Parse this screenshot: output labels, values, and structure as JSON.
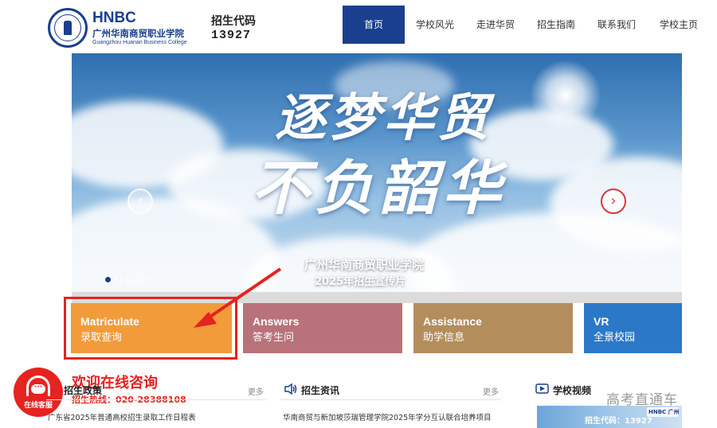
{
  "header": {
    "logo_seal_text": "广州华南商贸",
    "logo_abbr": "HNBC",
    "logo_name_cn": "广州华南商贸职业学院",
    "logo_name_en": "Guangzhou Huanan Business College",
    "code_label": "招生代码",
    "code_value": "13927"
  },
  "nav": {
    "items": [
      {
        "label": "首页",
        "active": true
      },
      {
        "label": "学校风光"
      },
      {
        "label": "走进华贸"
      },
      {
        "label": "招生指南"
      },
      {
        "label": "联系我们"
      },
      {
        "label": "学校主页"
      }
    ]
  },
  "banner": {
    "slogan_line1": "逐梦华贸",
    "slogan_line2": "不负韶华",
    "caption_line1": "广州华南商贸职业学院",
    "caption_line2": "2025年招生宣传片",
    "prev_glyph": "‹",
    "next_glyph": "›",
    "slides_total": 5,
    "slide_active": 1
  },
  "tiles": [
    {
      "en": "Matriculate",
      "cn": "录取查询",
      "color": "#f29b3a"
    },
    {
      "en": "Answers",
      "cn": "答考生问",
      "color": "#b9727a"
    },
    {
      "en": "Assistance",
      "cn": "助学信息",
      "color": "#b48d5c"
    },
    {
      "en": "VR",
      "cn": "全景校园",
      "color": "#2c78c8"
    }
  ],
  "support": {
    "label": "在线客服",
    "bubble": "···",
    "welcome": "欢迎在线咨询",
    "hotline": "招生热线：020-28388108"
  },
  "sections": {
    "policy": {
      "title": "招生政策",
      "more": "更多",
      "item": "广东省2025年普通高校招生录取工作日程表"
    },
    "news": {
      "title": "招生资讯",
      "more": "更多",
      "item": "华南商贸与新加坡莎瑞管理学院2025年学分互认联合培养项目"
    },
    "video": {
      "title": "学校视频",
      "thumb_code": "招生代码：13927",
      "thumb_logo": "HNBC 广州华南商贸职业学院"
    }
  },
  "watermark": "高考直通车",
  "colors": {
    "brand_blue": "#1a3f8f",
    "highlight_red": "#e5231f"
  }
}
